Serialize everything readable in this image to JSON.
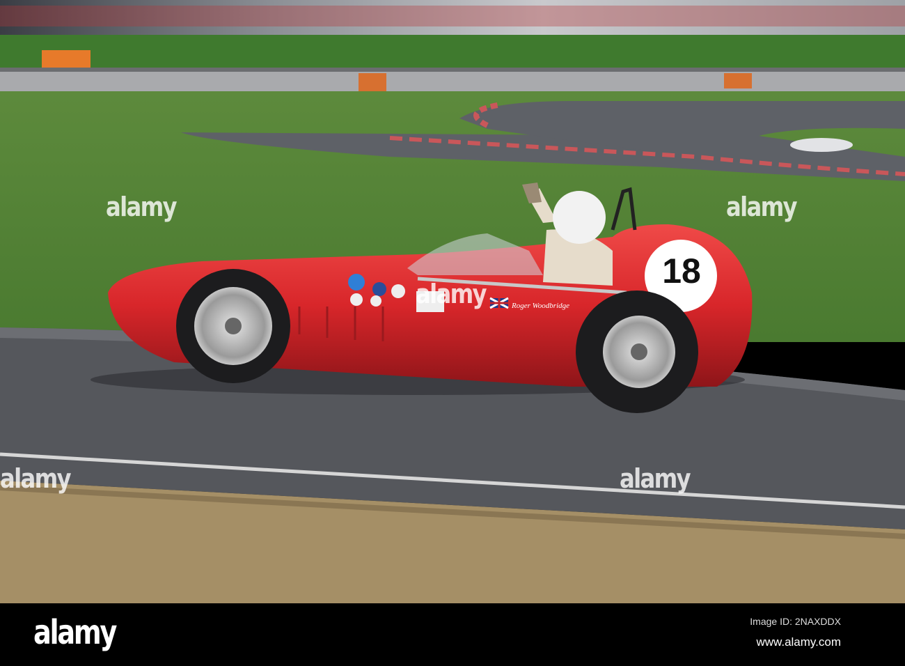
{
  "photo": {
    "subject": "red vintage single-seat racing car on track",
    "car_number": "18",
    "driver_name": "Roger Woodbridge",
    "colors": {
      "car": "#d8262a",
      "grass": "#4f7d34",
      "track": "#55575c",
      "sand": "#a58f66"
    }
  },
  "watermark": {
    "text": "alamy"
  },
  "footer": {
    "logo": "alamy",
    "image_id": "Image ID: 2NAXDDX",
    "url": "www.alamy.com"
  }
}
